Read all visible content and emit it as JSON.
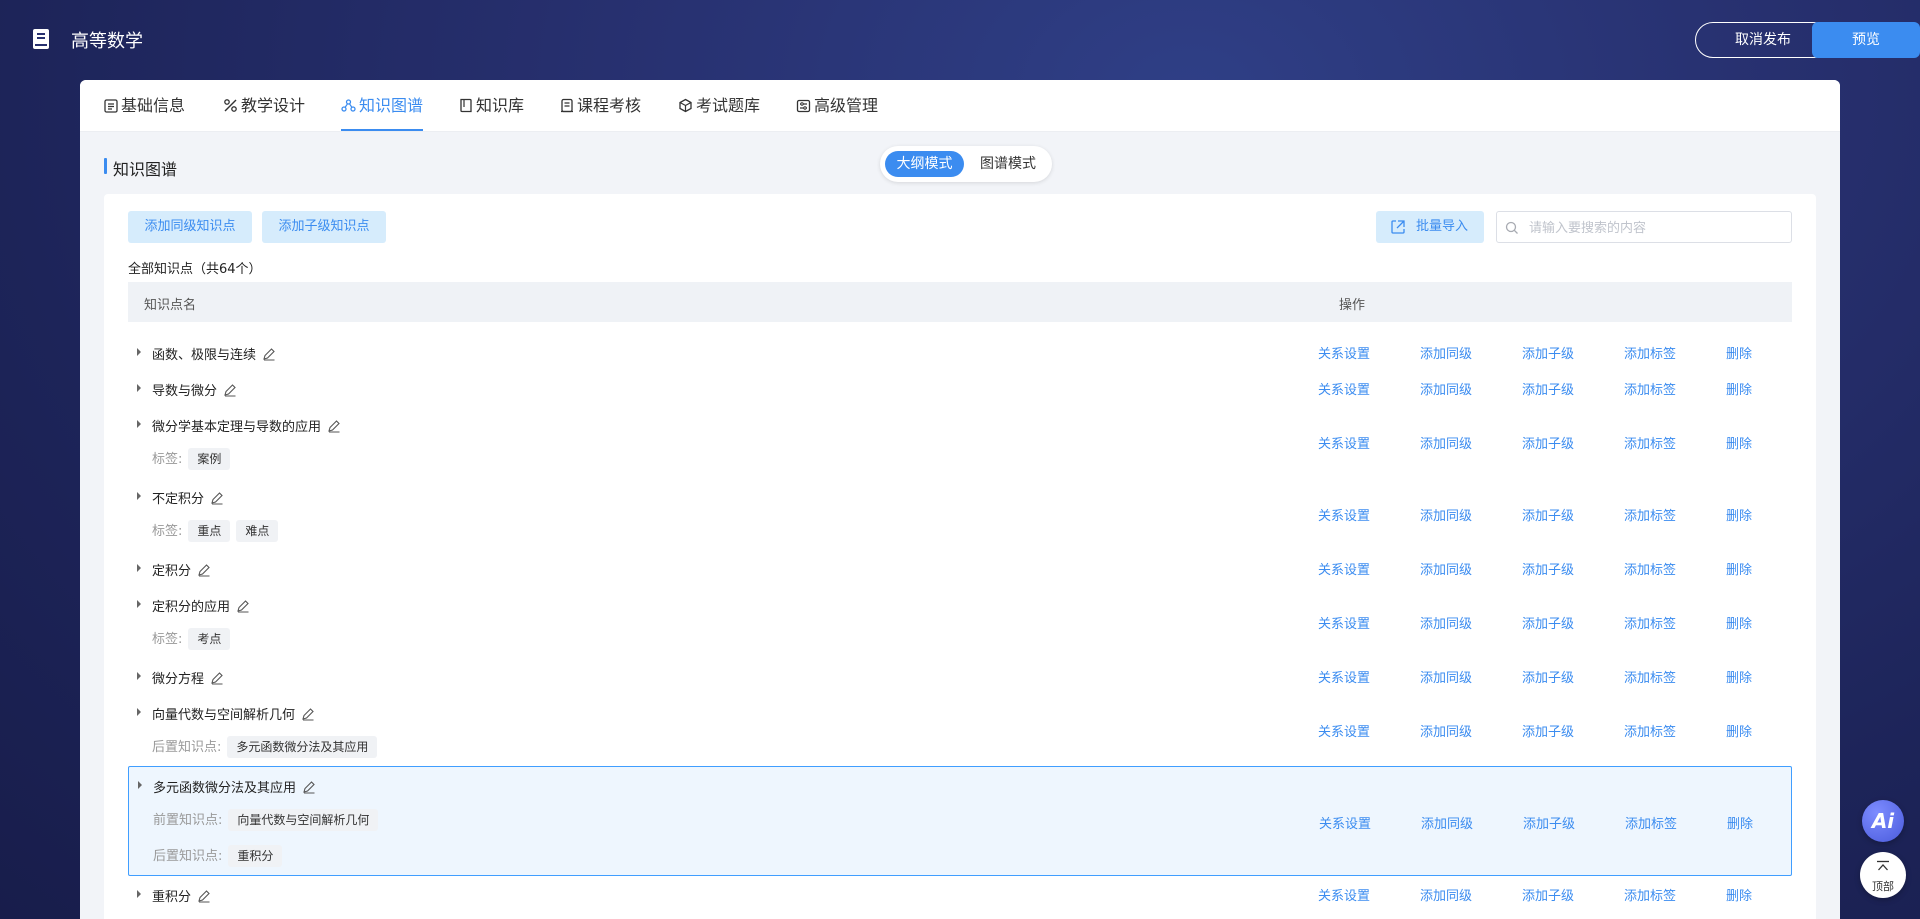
{
  "header": {
    "title": "高等数学",
    "unpublish_label": "取消发布",
    "preview_label": "预览"
  },
  "tabs": [
    {
      "label": "基础信息",
      "icon": "list-icon"
    },
    {
      "label": "教学设计",
      "icon": "tools-icon"
    },
    {
      "label": "知识图谱",
      "icon": "graph-icon",
      "active": true
    },
    {
      "label": "知识库",
      "icon": "book-icon"
    },
    {
      "label": "课程考核",
      "icon": "exam-icon"
    },
    {
      "label": "考试题库",
      "icon": "cube-icon"
    },
    {
      "label": "高级管理",
      "icon": "settings-panel-icon"
    }
  ],
  "section": {
    "title": "知识图谱",
    "mode_outline": "大纲模式",
    "mode_graph": "图谱模式"
  },
  "toolbar": {
    "add_sibling": "添加同级知识点",
    "add_child": "添加子级知识点",
    "batch_import": "批量导入",
    "search_placeholder": "请输入要搜索的内容"
  },
  "list": {
    "count_label": "全部知识点（共64个）",
    "col_name": "知识点名",
    "col_ops": "操作"
  },
  "actions": {
    "relation": "关系设置",
    "add_sibling": "添加同级",
    "add_child": "添加子级",
    "add_tag": "添加标签",
    "delete": "删除"
  },
  "rows": [
    {
      "name": "函数、极限与连续"
    },
    {
      "name": "导数与微分"
    },
    {
      "name": "微分学基本定理与导数的应用",
      "sub": [
        {
          "label": "标签:",
          "tags": [
            "案例"
          ]
        }
      ]
    },
    {
      "name": "不定积分",
      "sub": [
        {
          "label": "标签:",
          "tags": [
            "重点",
            "难点"
          ]
        }
      ]
    },
    {
      "name": "定积分"
    },
    {
      "name": "定积分的应用",
      "sub": [
        {
          "label": "标签:",
          "tags": [
            "考点"
          ]
        }
      ]
    },
    {
      "name": "微分方程"
    },
    {
      "name": "向量代数与空间解析几何",
      "sub": [
        {
          "label": "后置知识点:",
          "tags": [
            "多元函数微分法及其应用"
          ]
        }
      ]
    },
    {
      "name": "多元函数微分法及其应用",
      "selected": true,
      "sub": [
        {
          "label": "前置知识点:",
          "tags": [
            "向量代数与空间解析几何"
          ]
        },
        {
          "label": "后置知识点:",
          "tags": [
            "重积分"
          ]
        }
      ]
    },
    {
      "name": "重积分"
    }
  ],
  "float": {
    "ai_label": "Ai",
    "top_label": "顶部"
  },
  "colors": {
    "accent": "#3b8cf0",
    "selected_row_bg": "#eef6fe",
    "button_light_bg": "#d6ecfc"
  }
}
